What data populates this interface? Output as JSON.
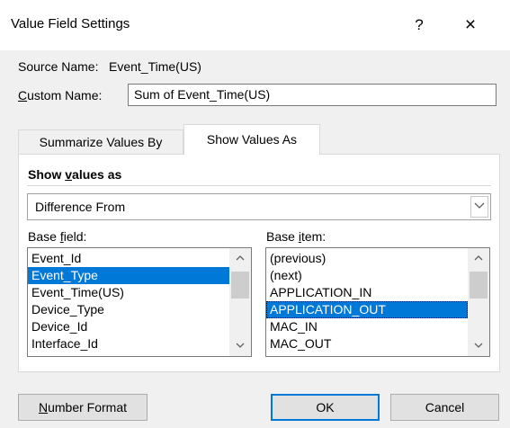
{
  "window": {
    "title": "Value Field Settings",
    "help_label": "?",
    "close_label": "×"
  },
  "source": {
    "label": "Source Name:",
    "value": "Event_Time(US)"
  },
  "custom_name": {
    "label_accel": "C",
    "label_rest": "ustom Name:",
    "value": "Sum of Event_Time(US)"
  },
  "tabs": [
    {
      "label": "Summarize Values By",
      "active": false
    },
    {
      "label": "Show Values As",
      "active": true
    }
  ],
  "show_values": {
    "heading_pre": "Show ",
    "heading_accel": "v",
    "heading_post": "alues as",
    "selected": "Difference From"
  },
  "base_field": {
    "label_pre": "Base ",
    "label_accel": "f",
    "label_post": "ield:",
    "items": [
      "Event_Id",
      "Event_Type",
      "Event_Time(US)",
      "Device_Type",
      "Device_Id",
      "Interface_Id"
    ],
    "selected_index": 1
  },
  "base_item": {
    "label_pre": "Base ",
    "label_accel": "i",
    "label_post": "tem:",
    "items": [
      "(previous)",
      "(next)",
      "APPLICATION_IN",
      "APPLICATION_OUT",
      "MAC_IN",
      "MAC_OUT"
    ],
    "selected_index": 3
  },
  "buttons": {
    "number_format_accel": "N",
    "number_format_rest": "umber Format",
    "ok": "OK",
    "cancel": "Cancel"
  },
  "icons": {
    "dropdown": "chevron-down-icon",
    "scroll_up": "chevron-up-icon",
    "scroll_down": "chevron-down-icon"
  },
  "colors": {
    "selection": "#0078d7",
    "default_button_border": "#0078d7"
  }
}
